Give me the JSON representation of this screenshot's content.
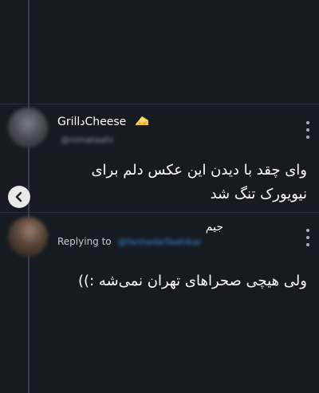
{
  "tweets": [
    {
      "display_name": "GrillدCheese",
      "name_icon": "cheese-icon",
      "handle": "@nimataahi",
      "text": "وای چقد با دیدن این عکس دلم برای نیویورک تنگ شد"
    },
    {
      "display_name": "جیم",
      "replying_to_label": "Replying to",
      "replying_to_handle": "@fanhadarfaahikar",
      "text": "ولی هیچی صحراهای تهران نمی‌شه :))"
    }
  ],
  "colors": {
    "background": "#161b22",
    "text": "#ffffff",
    "secondary_text": "#8a939e",
    "link": "#3d8ad4"
  }
}
